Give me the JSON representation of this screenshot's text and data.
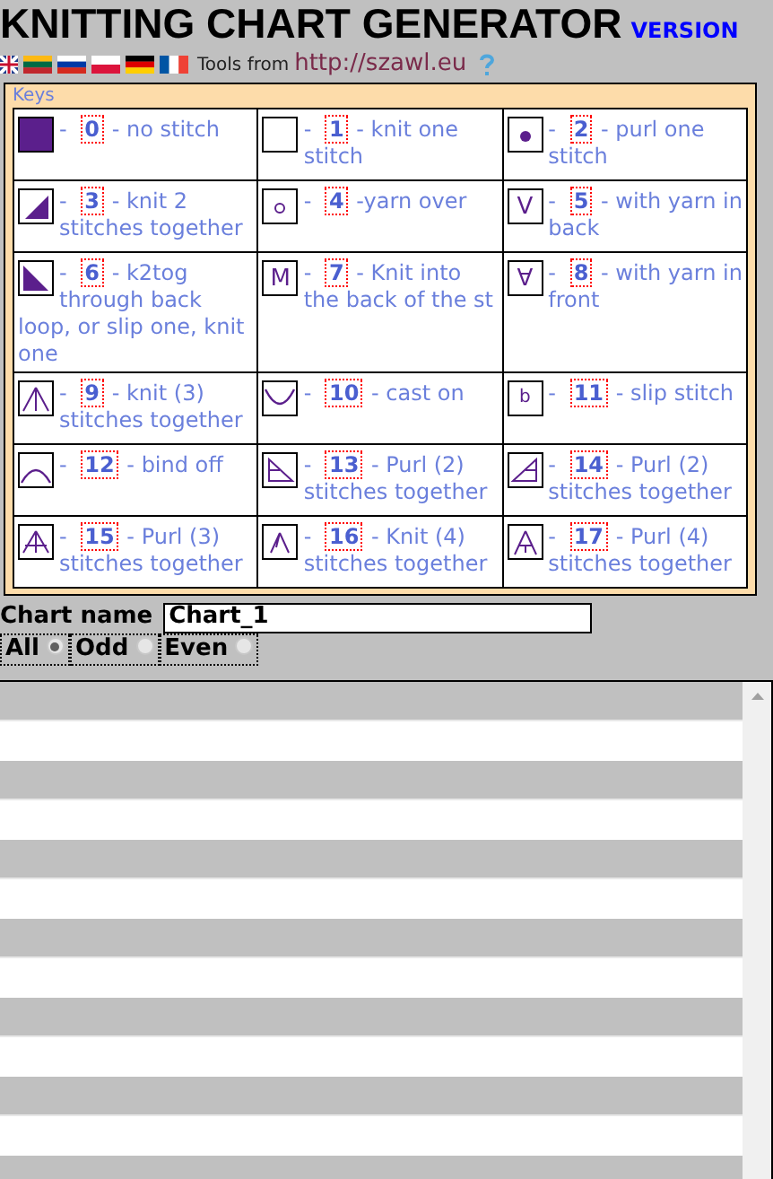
{
  "title": "KNITTING CHART GENERATOR",
  "version_link": "VERSION",
  "tools_text": "Tools from",
  "tools_link": "http://szawl.eu",
  "keys_legend": "Keys",
  "keys": [
    {
      "kind": "filled",
      "dash": "-",
      "number": "0",
      "text": "- no stitch"
    },
    {
      "kind": "empty",
      "dash": "-",
      "number": "1",
      "text": "- knit one stitch"
    },
    {
      "kind": "dot",
      "dash": "-",
      "number": "2",
      "text": "- purl one stitch"
    },
    {
      "kind": "triangle-right",
      "dash": "-",
      "number": "3",
      "text": "- knit 2 stitches together"
    },
    {
      "kind": "ring",
      "dash": "-",
      "number": "4",
      "text": "-yarn over"
    },
    {
      "kind": "glyph",
      "glyph": "V",
      "dash": "-",
      "number": "5",
      "text": "- with yarn in back"
    },
    {
      "kind": "triangle-left",
      "dash": "-",
      "number": "6",
      "text": "- k2tog through back loop, or slip one, knit one"
    },
    {
      "kind": "glyph",
      "glyph": "M",
      "dash": "-",
      "number": "7",
      "text": "- Knit into the back of the st"
    },
    {
      "kind": "glyph",
      "glyph": "∀",
      "dash": "-",
      "number": "8",
      "text": "- with yarn in front"
    },
    {
      "kind": "fan",
      "dash": "-",
      "number": "9",
      "text": "- knit (3) stitches together"
    },
    {
      "kind": "cup",
      "dash": "-",
      "number": "10",
      "text": "- cast on"
    },
    {
      "kind": "glyph",
      "glyph": "b",
      "dash": "-",
      "number": "11",
      "text": "- slip stitch"
    },
    {
      "kind": "arch",
      "dash": "-",
      "number": "12",
      "text": "- bind off"
    },
    {
      "kind": "purl-left",
      "dash": "-",
      "number": "13",
      "text": "- Purl (2) stitches together"
    },
    {
      "kind": "purl-right",
      "dash": "-",
      "number": "14",
      "text": "- Purl (2) stitches together"
    },
    {
      "kind": "purl-fan",
      "dash": "-",
      "number": "15",
      "text": "- Purl (3) stitches together"
    },
    {
      "kind": "knit-four",
      "dash": "-",
      "number": "16",
      "text": "- Knit (4) stitches together"
    },
    {
      "kind": "purl-four",
      "dash": "-",
      "number": "17",
      "text": "- Purl (4) stitches together"
    }
  ],
  "chart_name_label": "Chart name",
  "chart_name": "Chart_1",
  "rows_filter": [
    {
      "label": "All",
      "selected": true
    },
    {
      "label": "Odd",
      "selected": false
    },
    {
      "label": "Even",
      "selected": false
    }
  ]
}
